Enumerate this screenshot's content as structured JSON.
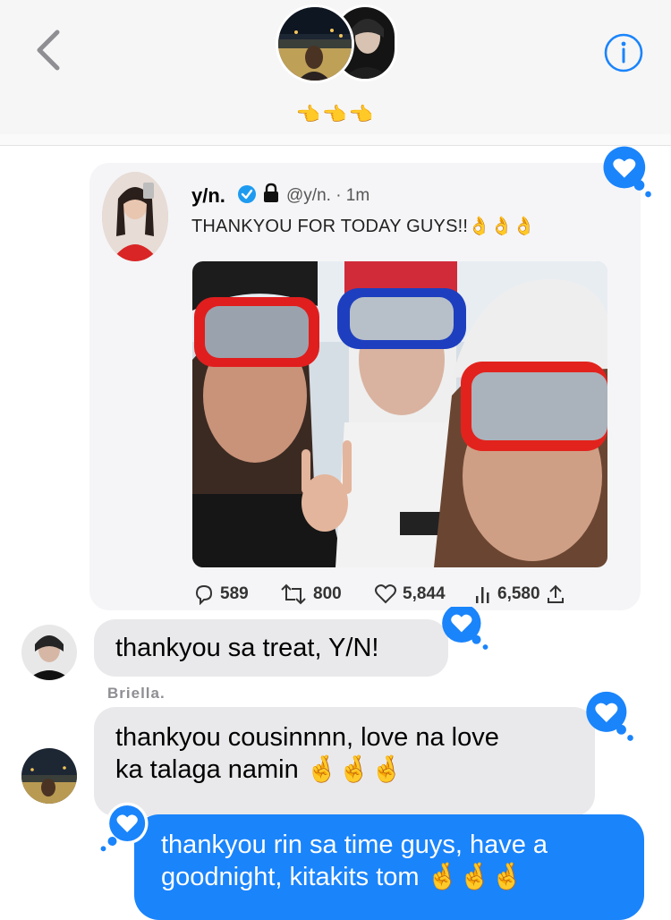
{
  "header": {
    "group_name": "👈👈👈",
    "icons": {
      "back": "chevron-left-icon",
      "info": "info-icon"
    }
  },
  "tweet": {
    "name": "y/n.",
    "handle_time": "@y/n. · 1m",
    "text": "THANKYOU FOR TODAY GUYS!!👌👌👌",
    "stats": {
      "replies": "589",
      "retweets": "800",
      "likes": "5,844",
      "views": "6,580"
    },
    "icons": [
      "verified-icon",
      "lock-icon",
      "reply-icon",
      "retweet-icon",
      "like-icon",
      "views-icon",
      "share-icon"
    ]
  },
  "messages": [
    {
      "from": "other",
      "text": "thankyou sa treat, Y/N!"
    },
    {
      "from": "other",
      "sender": "Briella.",
      "line1": "thankyou cousinnnn, love na love",
      "line2": "ka talaga namin 🤞🤞🤞"
    },
    {
      "from": "me",
      "line1": "thankyou rin sa time guys, have a",
      "line2": "goodnight, kitakits tom 🤞🤞🤞"
    }
  ],
  "colors": {
    "bubble_out": "#1a84fb",
    "bubble_in": "#e9e9eb",
    "accent": "#1a84fb",
    "header_bg": "#f6f6f6"
  }
}
